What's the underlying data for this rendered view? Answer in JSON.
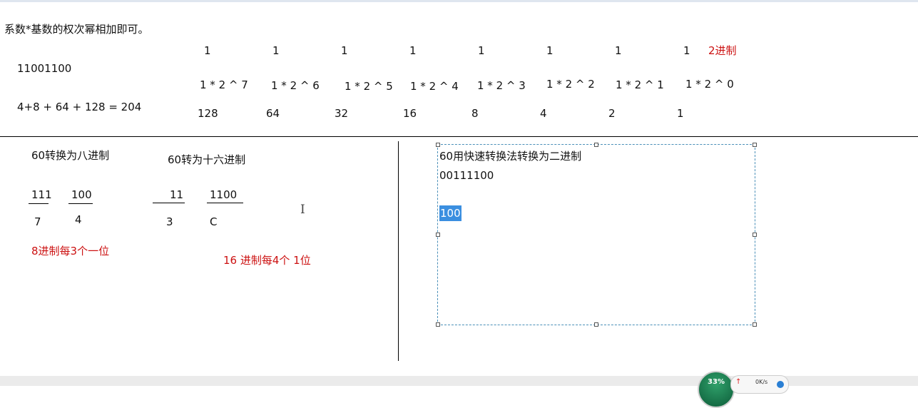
{
  "top": {
    "heading": "系数*基数的权次幂相加即可。",
    "binary_value": "11001100",
    "sum_formula": "4+8 + 64 + 128 = 204",
    "bits": [
      "1",
      "1",
      "1",
      "1",
      "1",
      "1",
      "1",
      "1"
    ],
    "base_note": "2进制",
    "powers": [
      "1 * 2 ^ 7",
      "1 * 2 ^ 6",
      "1 * 2 ^ 5",
      "1 * 2 ^ 4",
      "1 * 2 ^ 3",
      "1 * 2 ^ 2",
      "1 * 2 ^ 1",
      "1 * 2 ^ 0"
    ],
    "weights": [
      "128",
      "64",
      "32",
      "16",
      "8",
      "4",
      "2",
      "1"
    ]
  },
  "octal": {
    "title": "60转换为八进制",
    "groups": [
      "111",
      "100"
    ],
    "digits": [
      "7",
      "4"
    ],
    "note": "8进制每3个一位"
  },
  "hex": {
    "title": "60转为十六进制",
    "groups": [
      "11",
      "1100"
    ],
    "digits": [
      "3",
      "C"
    ],
    "note": "16 进制每4个 1位"
  },
  "textbox": {
    "line1": "60用快速转换法转换为二进制",
    "line2": "00111100",
    "selected": "100"
  },
  "taskbar": {
    "percent": "33%",
    "net_speed": "0K/s"
  },
  "colors": {
    "annotation_red": "#cc1111",
    "selection_blue": "#3b8fe0",
    "selection_border": "#4a8fb8"
  }
}
